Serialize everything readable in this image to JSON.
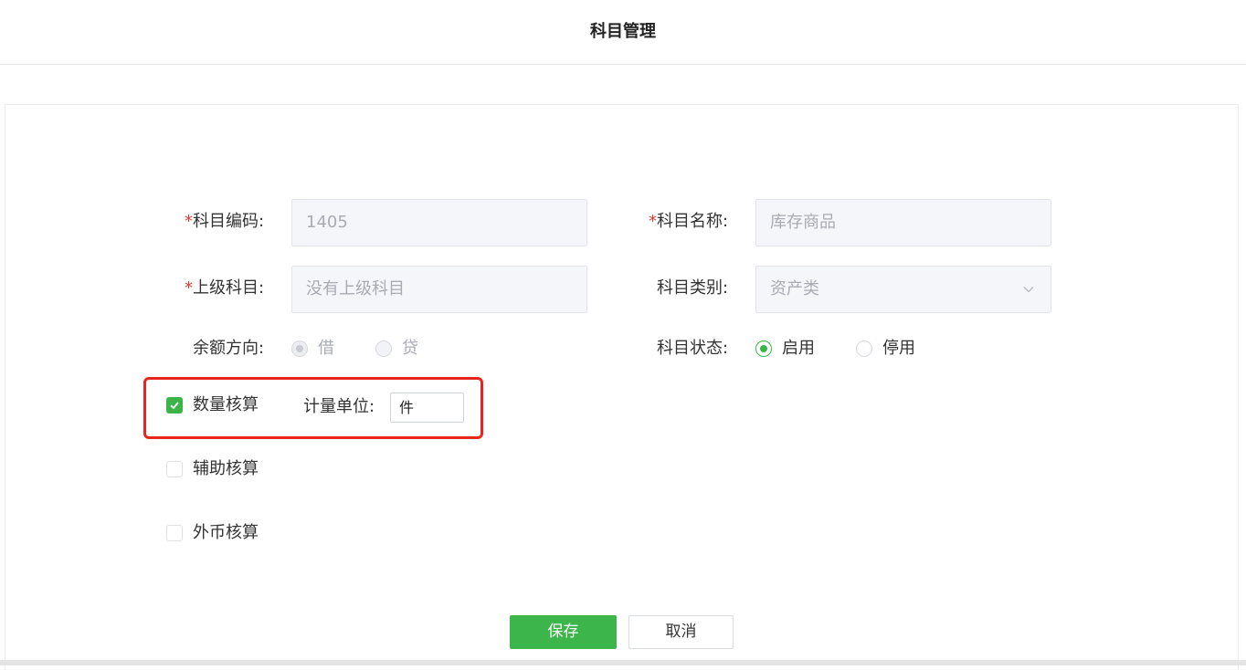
{
  "header": {
    "title": "科目管理"
  },
  "form": {
    "required_mark": "*",
    "code": {
      "label": "科目编码:",
      "value": "1405"
    },
    "name": {
      "label": "科目名称:",
      "value": "库存商品"
    },
    "parent": {
      "label": "上级科目:",
      "placeholder": "没有上级科目"
    },
    "category": {
      "label": "科目类别:",
      "value": "资产类"
    },
    "balance_direction": {
      "label": "余额方向:",
      "options": [
        "借",
        "贷"
      ],
      "selected": "借",
      "disabled": true
    },
    "status": {
      "label": "科目状态:",
      "options": [
        "启用",
        "停用"
      ],
      "selected": "启用"
    },
    "quantity_accounting": {
      "label": "数量核算",
      "checked": true,
      "unit_label": "计量单位:",
      "unit_value": "件"
    },
    "auxiliary_accounting": {
      "label": "辅助核算",
      "checked": false
    },
    "foreign_currency_accounting": {
      "label": "外币核算",
      "checked": false
    }
  },
  "actions": {
    "save_label": "保存",
    "cancel_label": "取消"
  },
  "colors": {
    "accent": "#3bb54a",
    "highlight": "#e8261e",
    "required": "#e53935"
  },
  "icons": {
    "dropdown": "chevron-down-icon",
    "checked": "checkmark-icon"
  }
}
